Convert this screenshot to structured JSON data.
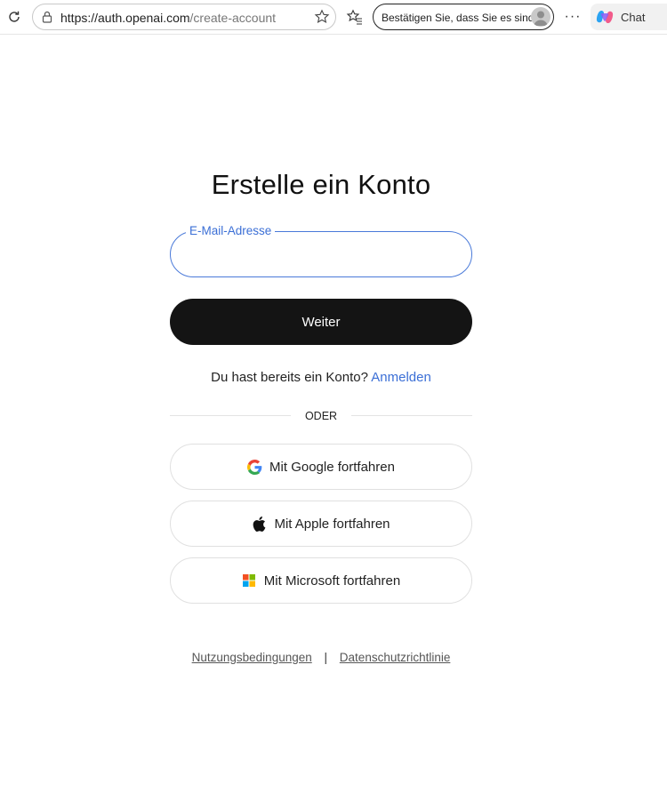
{
  "browser": {
    "url_host": "https://auth.openai.com",
    "url_path": "/create-account",
    "profile_text": "Bestätigen Sie, dass Sie es sind",
    "more_label": "···",
    "chat_label": "Chat"
  },
  "page": {
    "title": "Erstelle ein Konto",
    "email": {
      "label": "E-Mail-Adresse",
      "value": "",
      "placeholder": ""
    },
    "continue_label": "Weiter",
    "have_account_text": "Du hast bereits ein Konto?",
    "login_link": "Anmelden",
    "divider_text": "ODER",
    "social": {
      "google": "Mit Google fortfahren",
      "apple": "Mit Apple fortfahren",
      "microsoft": "Mit Microsoft fortfahren"
    },
    "footer": {
      "terms": "Nutzungsbedingungen",
      "separator": "|",
      "privacy": "Datenschutzrichtlinie"
    }
  },
  "colors": {
    "accent": "#3b6fd6",
    "primary_button": "#141414"
  },
  "icons": [
    "refresh-icon",
    "lock-icon",
    "star-icon",
    "favorites-icon",
    "avatar",
    "copilot-icon",
    "google-icon",
    "apple-icon",
    "microsoft-icon"
  ]
}
